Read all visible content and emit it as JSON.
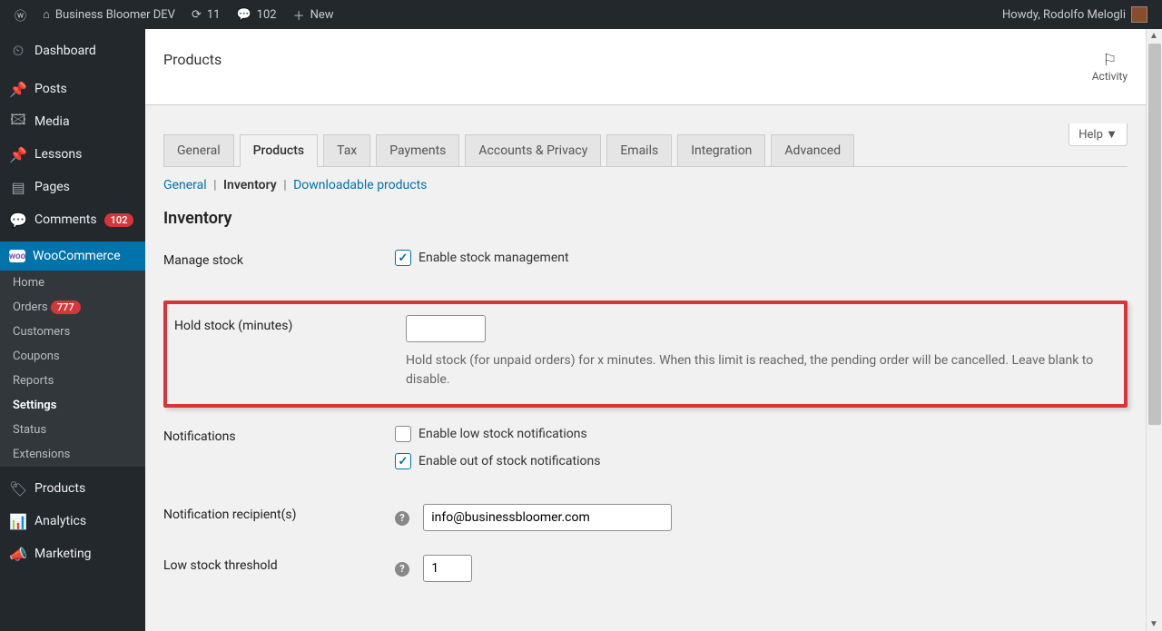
{
  "adminbar": {
    "site_name": "Business Bloomer DEV",
    "updates": "11",
    "comments": "102",
    "new": "New",
    "howdy": "Howdy, Rodolfo Melogli"
  },
  "sidebar": {
    "dashboard": "Dashboard",
    "posts": "Posts",
    "media": "Media",
    "lessons": "Lessons",
    "pages": "Pages",
    "comments": "Comments",
    "comments_badge": "102",
    "woocommerce": "WooCommerce",
    "sub": {
      "home": "Home",
      "orders": "Orders",
      "orders_badge": "777",
      "customers": "Customers",
      "coupons": "Coupons",
      "reports": "Reports",
      "settings": "Settings",
      "status": "Status",
      "extensions": "Extensions"
    },
    "products": "Products",
    "analytics": "Analytics",
    "marketing": "Marketing"
  },
  "header": {
    "title": "Products",
    "activity": "Activity",
    "help": "Help"
  },
  "tabs": {
    "general": "General",
    "products": "Products",
    "tax": "Tax",
    "payments": "Payments",
    "accounts": "Accounts & Privacy",
    "emails": "Emails",
    "integration": "Integration",
    "advanced": "Advanced"
  },
  "subtabs": {
    "general": "General",
    "inventory": "Inventory",
    "downloadable": "Downloadable products"
  },
  "section_title": "Inventory",
  "rows": {
    "manage_stock": {
      "label": "Manage stock",
      "cb": "Enable stock management"
    },
    "hold_stock": {
      "label": "Hold stock (minutes)",
      "value": "",
      "desc": "Hold stock (for unpaid orders) for x minutes. When this limit is reached, the pending order will be cancelled. Leave blank to disable."
    },
    "notifications": {
      "label": "Notifications",
      "low": "Enable low stock notifications",
      "out": "Enable out of stock notifications"
    },
    "recipient": {
      "label": "Notification recipient(s)",
      "value": "info@businessbloomer.com"
    },
    "low_threshold": {
      "label": "Low stock threshold",
      "value": "1"
    }
  }
}
